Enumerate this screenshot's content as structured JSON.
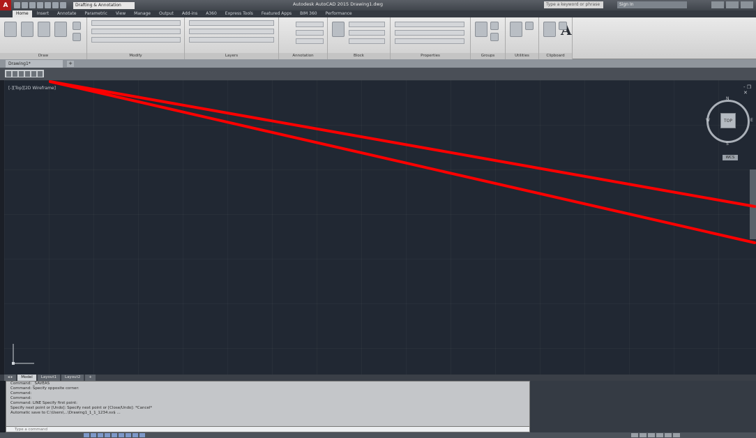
{
  "titlebar": {
    "app_logo": "A",
    "workspace": "Drafting & Annotation",
    "title": "Autodesk AutoCAD 2015  Drawing1.dwg",
    "search_placeholder": "Type a keyword or phrase",
    "signin": "Sign In"
  },
  "ribbon": {
    "tabs": [
      "Home",
      "Insert",
      "Annotate",
      "Parametric",
      "View",
      "Manage",
      "Output",
      "Add-ins",
      "A360",
      "Express Tools",
      "Featured Apps",
      "BIM 360",
      "Performance"
    ],
    "panels": [
      "Draw",
      "Modify",
      "Layers",
      "Annotation",
      "Block",
      "Properties",
      "Groups",
      "Utilities",
      "Clipboard"
    ],
    "big_a": "A"
  },
  "doc": {
    "tab_label": "Drawing1*",
    "add": "+"
  },
  "viewport": {
    "label": "[-][Top][2D Wireframe]",
    "close": "- ❐ ✕",
    "viewcube": {
      "face": "TOP",
      "n": "N",
      "w": "W",
      "e": "E",
      "s": "S"
    },
    "wcs": "WCS"
  },
  "layout_tabs": [
    "◂ ▸",
    "Model",
    "Layout1",
    "Layout2",
    "+"
  ],
  "command": {
    "lines": [
      "Command: _SAVEAS",
      "Command: Specify opposite corner:",
      "Command:",
      "Command:",
      "Command: LINE Specify first point:",
      "Specify next point or [Undo]: Specify next point or [Close/Undo]: *Cancel*",
      "Automatic save to C:\\Users\\...\\Drawing1_1_1_1234.sv$ ..."
    ],
    "input_placeholder": "Type a command"
  },
  "annotation": {
    "color": "#ff0000"
  }
}
